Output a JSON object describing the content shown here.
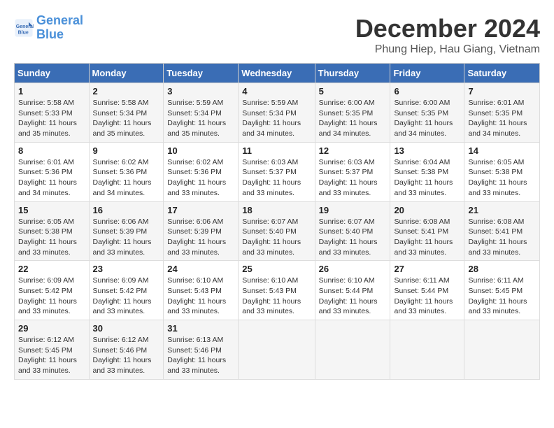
{
  "header": {
    "logo_line1": "General",
    "logo_line2": "Blue",
    "title": "December 2024",
    "subtitle": "Phung Hiep, Hau Giang, Vietnam"
  },
  "days_of_week": [
    "Sunday",
    "Monday",
    "Tuesday",
    "Wednesday",
    "Thursday",
    "Friday",
    "Saturday"
  ],
  "weeks": [
    [
      {
        "day": "1",
        "detail": "Sunrise: 5:58 AM\nSunset: 5:33 PM\nDaylight: 11 hours\nand 35 minutes."
      },
      {
        "day": "2",
        "detail": "Sunrise: 5:58 AM\nSunset: 5:34 PM\nDaylight: 11 hours\nand 35 minutes."
      },
      {
        "day": "3",
        "detail": "Sunrise: 5:59 AM\nSunset: 5:34 PM\nDaylight: 11 hours\nand 35 minutes."
      },
      {
        "day": "4",
        "detail": "Sunrise: 5:59 AM\nSunset: 5:34 PM\nDaylight: 11 hours\nand 34 minutes."
      },
      {
        "day": "5",
        "detail": "Sunrise: 6:00 AM\nSunset: 5:35 PM\nDaylight: 11 hours\nand 34 minutes."
      },
      {
        "day": "6",
        "detail": "Sunrise: 6:00 AM\nSunset: 5:35 PM\nDaylight: 11 hours\nand 34 minutes."
      },
      {
        "day": "7",
        "detail": "Sunrise: 6:01 AM\nSunset: 5:35 PM\nDaylight: 11 hours\nand 34 minutes."
      }
    ],
    [
      {
        "day": "8",
        "detail": "Sunrise: 6:01 AM\nSunset: 5:36 PM\nDaylight: 11 hours\nand 34 minutes."
      },
      {
        "day": "9",
        "detail": "Sunrise: 6:02 AM\nSunset: 5:36 PM\nDaylight: 11 hours\nand 34 minutes."
      },
      {
        "day": "10",
        "detail": "Sunrise: 6:02 AM\nSunset: 5:36 PM\nDaylight: 11 hours\nand 33 minutes."
      },
      {
        "day": "11",
        "detail": "Sunrise: 6:03 AM\nSunset: 5:37 PM\nDaylight: 11 hours\nand 33 minutes."
      },
      {
        "day": "12",
        "detail": "Sunrise: 6:03 AM\nSunset: 5:37 PM\nDaylight: 11 hours\nand 33 minutes."
      },
      {
        "day": "13",
        "detail": "Sunrise: 6:04 AM\nSunset: 5:38 PM\nDaylight: 11 hours\nand 33 minutes."
      },
      {
        "day": "14",
        "detail": "Sunrise: 6:05 AM\nSunset: 5:38 PM\nDaylight: 11 hours\nand 33 minutes."
      }
    ],
    [
      {
        "day": "15",
        "detail": "Sunrise: 6:05 AM\nSunset: 5:38 PM\nDaylight: 11 hours\nand 33 minutes."
      },
      {
        "day": "16",
        "detail": "Sunrise: 6:06 AM\nSunset: 5:39 PM\nDaylight: 11 hours\nand 33 minutes."
      },
      {
        "day": "17",
        "detail": "Sunrise: 6:06 AM\nSunset: 5:39 PM\nDaylight: 11 hours\nand 33 minutes."
      },
      {
        "day": "18",
        "detail": "Sunrise: 6:07 AM\nSunset: 5:40 PM\nDaylight: 11 hours\nand 33 minutes."
      },
      {
        "day": "19",
        "detail": "Sunrise: 6:07 AM\nSunset: 5:40 PM\nDaylight: 11 hours\nand 33 minutes."
      },
      {
        "day": "20",
        "detail": "Sunrise: 6:08 AM\nSunset: 5:41 PM\nDaylight: 11 hours\nand 33 minutes."
      },
      {
        "day": "21",
        "detail": "Sunrise: 6:08 AM\nSunset: 5:41 PM\nDaylight: 11 hours\nand 33 minutes."
      }
    ],
    [
      {
        "day": "22",
        "detail": "Sunrise: 6:09 AM\nSunset: 5:42 PM\nDaylight: 11 hours\nand 33 minutes."
      },
      {
        "day": "23",
        "detail": "Sunrise: 6:09 AM\nSunset: 5:42 PM\nDaylight: 11 hours\nand 33 minutes."
      },
      {
        "day": "24",
        "detail": "Sunrise: 6:10 AM\nSunset: 5:43 PM\nDaylight: 11 hours\nand 33 minutes."
      },
      {
        "day": "25",
        "detail": "Sunrise: 6:10 AM\nSunset: 5:43 PM\nDaylight: 11 hours\nand 33 minutes."
      },
      {
        "day": "26",
        "detail": "Sunrise: 6:10 AM\nSunset: 5:44 PM\nDaylight: 11 hours\nand 33 minutes."
      },
      {
        "day": "27",
        "detail": "Sunrise: 6:11 AM\nSunset: 5:44 PM\nDaylight: 11 hours\nand 33 minutes."
      },
      {
        "day": "28",
        "detail": "Sunrise: 6:11 AM\nSunset: 5:45 PM\nDaylight: 11 hours\nand 33 minutes."
      }
    ],
    [
      {
        "day": "29",
        "detail": "Sunrise: 6:12 AM\nSunset: 5:45 PM\nDaylight: 11 hours\nand 33 minutes."
      },
      {
        "day": "30",
        "detail": "Sunrise: 6:12 AM\nSunset: 5:46 PM\nDaylight: 11 hours\nand 33 minutes."
      },
      {
        "day": "31",
        "detail": "Sunrise: 6:13 AM\nSunset: 5:46 PM\nDaylight: 11 hours\nand 33 minutes."
      },
      {
        "day": "",
        "detail": ""
      },
      {
        "day": "",
        "detail": ""
      },
      {
        "day": "",
        "detail": ""
      },
      {
        "day": "",
        "detail": ""
      }
    ]
  ]
}
